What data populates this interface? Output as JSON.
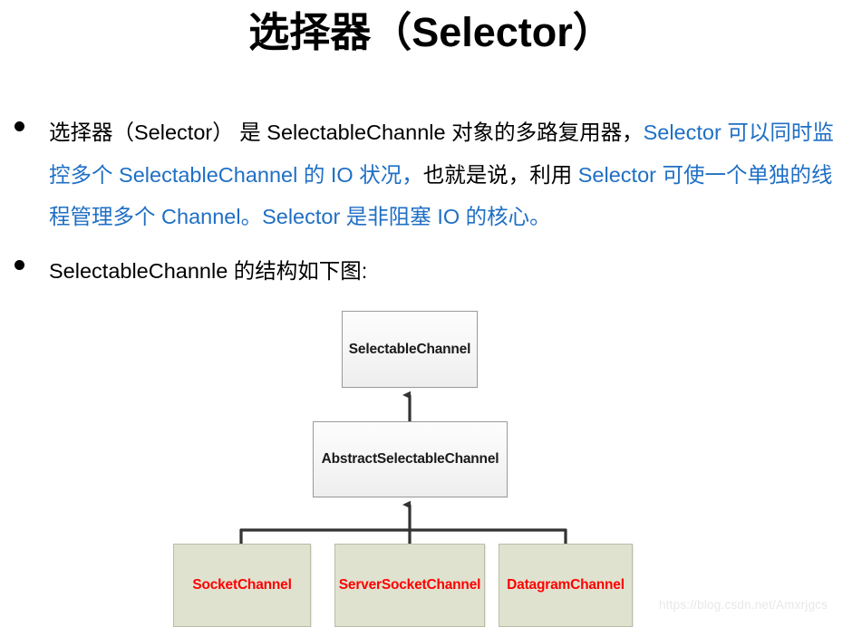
{
  "slide": {
    "title": "选择器（Selector）",
    "watermark": "https://blog.csdn.net/Amxrjgcs"
  },
  "bullets": [
    {
      "marker": "•",
      "runs": [
        {
          "text": "选择器（Selector） 是 SelectableChannle 对象的多路复用器，",
          "color": "black"
        },
        {
          "text": "Selector 可以同时监控多个 SelectableChannel 的 IO 状况，",
          "color": "blue"
        },
        {
          "text": "也就是说，利用 ",
          "color": "black"
        },
        {
          "text": "Selector 可使一个单独的线程管理多个 Channel。Selector 是非阻塞 IO 的核心。",
          "color": "blue"
        }
      ]
    },
    {
      "marker": "•",
      "runs": [
        {
          "text": "SelectableChannle 的结构如下图:",
          "color": "black"
        }
      ]
    }
  ],
  "diagram": {
    "type": "class-hierarchy",
    "nodes": [
      {
        "id": "selectablechannel",
        "label": "SelectableChannel",
        "style": "gray"
      },
      {
        "id": "abstractselectablechannel",
        "label": "AbstractSelectableChannel",
        "style": "gray"
      },
      {
        "id": "socketchannel",
        "label": "SocketChannel",
        "style": "green"
      },
      {
        "id": "serversocketchannel",
        "label": "ServerSocketChannel",
        "style": "green"
      },
      {
        "id": "datagramchannel",
        "label": "DatagramChannel",
        "style": "green"
      }
    ],
    "edges": [
      {
        "from": "abstractselectablechannel",
        "to": "selectablechannel",
        "kind": "inheritance-arrow"
      },
      {
        "from": "socketchannel",
        "to": "abstractselectablechannel",
        "kind": "inheritance-arrow"
      },
      {
        "from": "serversocketchannel",
        "to": "abstractselectablechannel",
        "kind": "inheritance-arrow"
      },
      {
        "from": "datagramchannel",
        "to": "abstractselectablechannel",
        "kind": "inheritance-arrow"
      }
    ],
    "colors": {
      "gray_fill": "#f5f5f5",
      "gray_border": "#9a9a9a",
      "green_fill": "#dfe2cf",
      "green_border": "#b9bda4",
      "node_text_red": "#ff0000",
      "node_text_black": "#1a1a1a",
      "connector": "#333333"
    }
  },
  "theme": {
    "accent_blue": "#1f6fc4",
    "background": "#ffffff",
    "body_text": "#000000"
  }
}
